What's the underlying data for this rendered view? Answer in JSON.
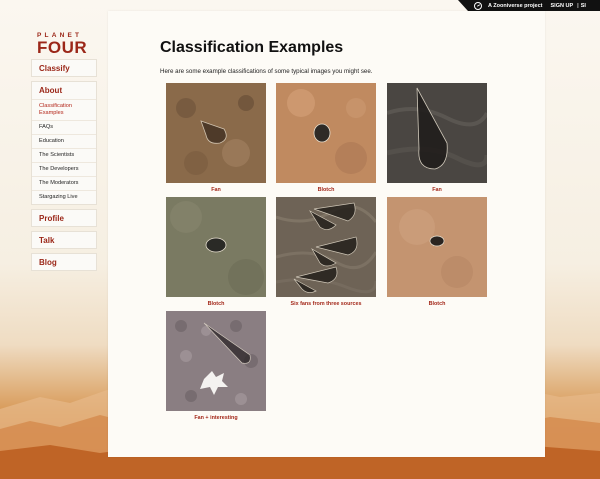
{
  "topbar": {
    "zooniverse": "A Zooniverse project",
    "sign_up": "SIGN UP",
    "separator": "|",
    "sign_in": "SI"
  },
  "brand": {
    "line1": "PLANET",
    "line2": "FOUR"
  },
  "nav": {
    "classify": "Classify",
    "about": {
      "label": "About",
      "items": [
        {
          "label": "Classification Examples",
          "active": true
        },
        {
          "label": "FAQs"
        },
        {
          "label": "Education"
        },
        {
          "label": "The Scientists"
        },
        {
          "label": "The Developers"
        },
        {
          "label": "The Moderators"
        },
        {
          "label": "Stargazing Live"
        }
      ]
    },
    "profile": "Profile",
    "talk": "Talk",
    "blog": "Blog"
  },
  "main": {
    "title": "Classification Examples",
    "intro": "Here are some example classifications of some typical images you might see.",
    "examples": [
      {
        "caption": "Fan",
        "tone": "#8a6a4a"
      },
      {
        "caption": "Blotch",
        "tone": "#c08a60"
      },
      {
        "caption": "Fan",
        "tone": "#4a4642"
      },
      {
        "caption": "Blotch",
        "tone": "#7a7a62"
      },
      {
        "caption": "Six fans from three sources",
        "tone": "#6e6356"
      },
      {
        "caption": "Blotch",
        "tone": "#c49470"
      },
      {
        "caption": "Fan + interesting",
        "tone": "#8a7e82"
      }
    ]
  },
  "colors": {
    "accent": "#9b2718",
    "topbar": "#111111"
  }
}
